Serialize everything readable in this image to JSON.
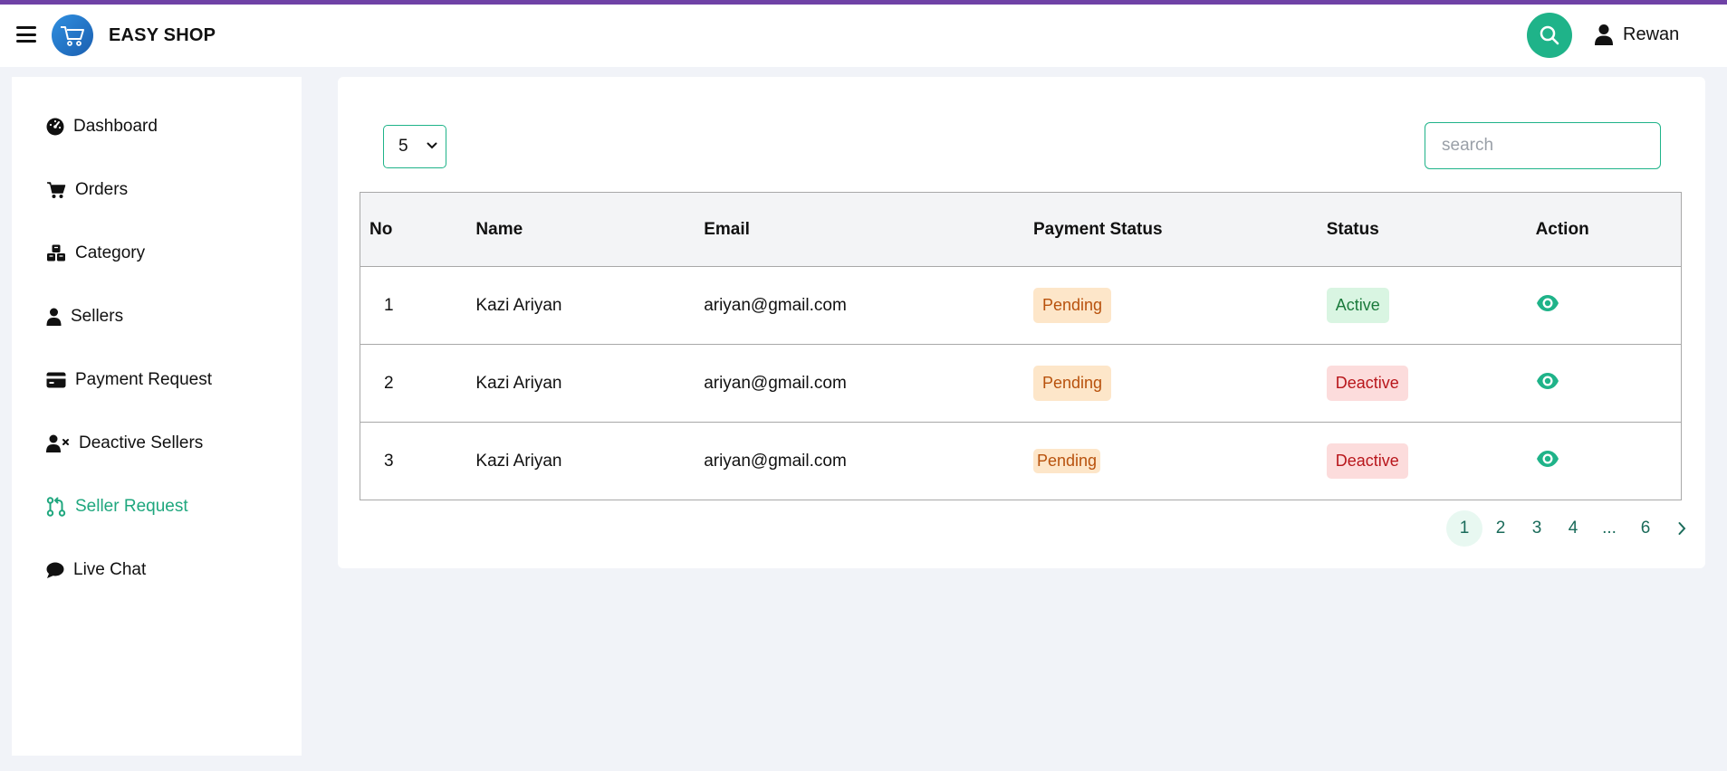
{
  "header": {
    "brand": "EASY SHOP",
    "user_name": "Rewan",
    "accent": "#1fb389"
  },
  "sidebar": {
    "items": [
      {
        "label": "Dashboard",
        "icon": "dashboard-icon"
      },
      {
        "label": "Orders",
        "icon": "cart-icon"
      },
      {
        "label": "Category",
        "icon": "cubes-icon"
      },
      {
        "label": "Sellers",
        "icon": "user-icon"
      },
      {
        "label": "Payment Request",
        "icon": "card-icon"
      },
      {
        "label": "Deactive Sellers",
        "icon": "user-x-icon"
      },
      {
        "label": "Seller Request",
        "icon": "git-pull-request-icon",
        "active": true
      },
      {
        "label": "Live Chat",
        "icon": "chat-icon"
      }
    ]
  },
  "main": {
    "page_size": "5",
    "search_placeholder": "search",
    "columns": [
      "No",
      "Name",
      "Email",
      "Payment Status",
      "Status",
      "Action"
    ],
    "rows": [
      {
        "no": "1",
        "name": "Kazi Ariyan",
        "email": "ariyan@gmail.com",
        "payment": "Pending",
        "status": "Active"
      },
      {
        "no": "2",
        "name": "Kazi Ariyan",
        "email": "ariyan@gmail.com",
        "payment": "Pending",
        "status": "Deactive"
      },
      {
        "no": "3",
        "name": "Kazi Ariyan",
        "email": "ariyan@gmail.com",
        "payment": "Pending",
        "status": "Deactive"
      }
    ],
    "pagination": {
      "pages": [
        "1",
        "2",
        "3",
        "4",
        "...",
        "6"
      ],
      "current": "1"
    }
  }
}
